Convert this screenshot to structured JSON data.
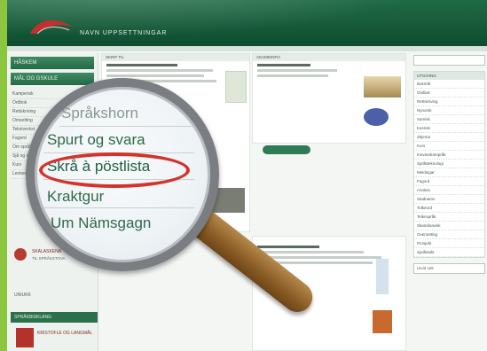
{
  "header": {
    "site_title": "NAVN UPPSETTNINGAR"
  },
  "sidebar": {
    "nav_button_1": "HÅSKEM",
    "nav_button_2": "MÅL OG GSKULE",
    "links": [
      "Kampensk",
      "Ordbok",
      "Rettskriving",
      "Omsetting",
      "Tekstverkst",
      "Fagord",
      "Om språket",
      "Sjå og les",
      "Kurs",
      "Lenker"
    ],
    "promo_title": "SKALASKENA",
    "promo_sub": "TIL SPRÅKSTOVA",
    "small_label": "UNIUKK",
    "bottom_button": "SPRÅKBISKLANG",
    "book_label": "KRISTOFLE OG LANGMÅL"
  },
  "main": {
    "col1_head": "SKRIF TIL",
    "col2_head": "AKUMEINFO"
  },
  "right": {
    "head": "UTGIVING",
    "items": [
      "Bokmål",
      "Ordbok",
      "Rettskriving",
      "Nynorsk",
      "Samisk",
      "Kvensk",
      "Skjema",
      "Kurs",
      "Innvandrarspråk",
      "Språkteknologi",
      "Meldingar",
      "Fagord",
      "Annleis",
      "Stadnamn",
      "Tolkeord",
      "Teiknspråk",
      "Skandinavisk",
      "Oversetting",
      "Prosjekt",
      "Språkrøkt"
    ],
    "search_bottom": "Utvid søk"
  },
  "magnifier": {
    "items": [
      "Språkshorn",
      "Spurt og svara",
      "Skrå à pöstlista",
      "Kraktgur",
      "Um Nämsgagn"
    ],
    "highlighted_index": 2
  }
}
